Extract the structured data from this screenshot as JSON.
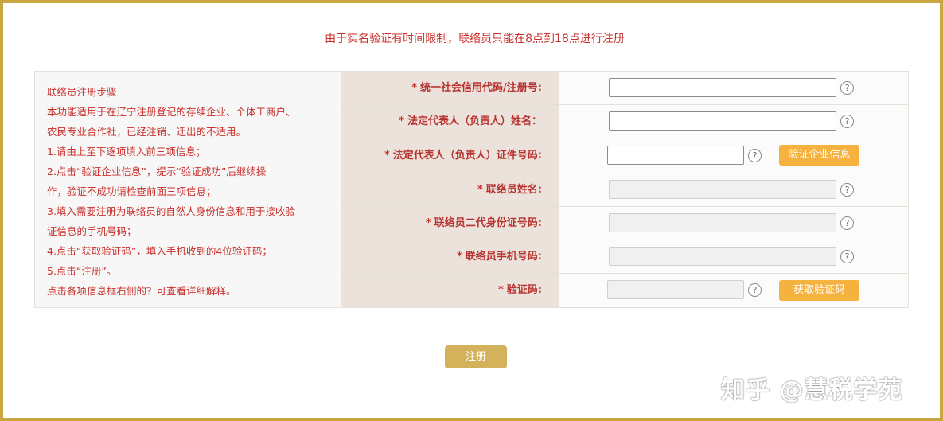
{
  "notice": "由于实名验证有时间限制，联络员只能在8点到18点进行注册",
  "instructions": [
    "联络员注册步骤",
    "本功能适用于在辽宁注册登记的存续企业、个体工商户、",
    "农民专业合作社，已经注销、迁出的不适用。",
    "1.请由上至下逐项填入前三项信息；",
    "2.点击“验证企业信息”，提示“验证成功”后继续操",
    "作，验证不成功请检查前面三项信息；",
    "3.填入需要注册为联络员的自然人身份信息和用于接收验",
    "证信息的手机号码；",
    "4.点击“获取验证码”，填入手机收到的4位验证码；",
    "5.点击“注册”。",
    "点击各项信息框右侧的？可查看详细解释。"
  ],
  "fields": [
    {
      "star": "*",
      "label": "统一社会信用代码/注册号:",
      "value": ""
    },
    {
      "star": "*",
      "label": "法定代表人（负责人）姓名：",
      "value": ""
    },
    {
      "star": "*",
      "label": "法定代表人（负责人）证件号码:",
      "value": ""
    },
    {
      "star": "*",
      "label": "联络员姓名:",
      "value": ""
    },
    {
      "star": "*",
      "label": "联络员二代身份证号码:",
      "value": ""
    },
    {
      "star": "*",
      "label": "联络员手机号码:",
      "value": ""
    },
    {
      "star": "*",
      "label": "验证码:",
      "value": ""
    }
  ],
  "help_glyph": "?",
  "verify_button": "验证企业信息",
  "get_code_button": "获取验证码",
  "register_button": "注册",
  "watermark": "知乎 @慧税学苑",
  "colors": {
    "frame": "#c9a63f",
    "notice_text": "#c9302c",
    "label_text": "#b8322f",
    "orange_button": "#f6b23f",
    "register_button": "#d4b25c"
  }
}
